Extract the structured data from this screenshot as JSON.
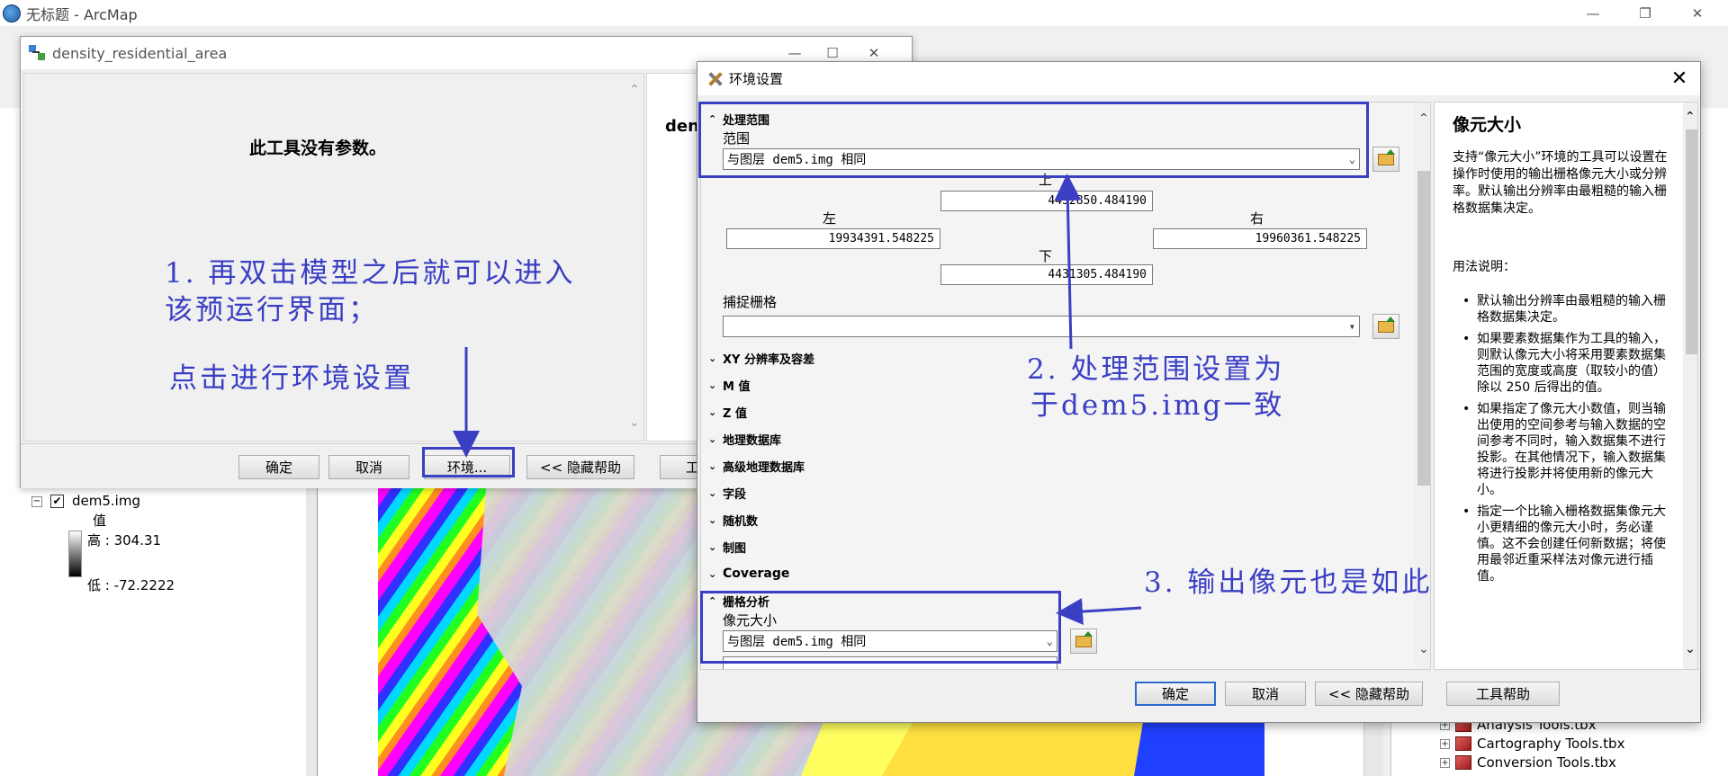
{
  "arcmap": {
    "title": "无标题 - ArcMap",
    "toc": {
      "layer_name": "dem5.img",
      "legend_header": "值",
      "high_label": "高 : 304.31",
      "low_label": "低 : -72.2222"
    },
    "catalog_items": [
      "Analysis Tools.tbx",
      "Cartography Tools.tbx",
      "Conversion Tools.tbx"
    ]
  },
  "tool_dialog": {
    "title": "density_residential_area",
    "no_params": "此工具没有参数。",
    "help_heading": "den",
    "buttons": {
      "ok": "确定",
      "cancel": "取消",
      "env": "环境...",
      "hide_help": "<< 隐藏帮助",
      "tool_help": "工"
    }
  },
  "env_dialog": {
    "title": "环境设置",
    "sections": {
      "extent": "处理范围",
      "xy": "XY 分辨率及容差",
      "m": "M 值",
      "z": "Z 值",
      "geodatabase": "地理数据库",
      "adv_geodatabase": "高级地理数据库",
      "fields": "字段",
      "random": "随机数",
      "cartography": "制图",
      "coverage": "Coverage",
      "raster": "栅格分析"
    },
    "extent": {
      "label": "范围",
      "value": "与图层 dem5.img 相同",
      "top_label": "上",
      "top": "4452850.484190",
      "left_label": "左",
      "left": "19934391.548225",
      "right_label": "右",
      "right": "19960361.548225",
      "bottom_label": "下",
      "bottom": "4431305.484190",
      "snap_label": "捕捉栅格",
      "snap_value": ""
    },
    "raster": {
      "cell_size_label": "像元大小",
      "cell_size_value": "与图层 dem5.img 相同"
    },
    "help": {
      "title": "像元大小",
      "intro": "支持“像元大小”环境的工具可以设置在操作时使用的输出栅格像元大小或分辨率。默认输出分辨率由最粗糙的输入栅格数据集决定。",
      "usage": "用法说明：",
      "bullets": [
        "默认输出分辨率由最粗糙的输入栅格数据集决定。",
        "如果要素数据集作为工具的输入，则默认像元大小将采用要素数据集范围的宽度或高度（取较小的值）除以 250 后得出的值。",
        "如果指定了像元大小数值，则当输出使用的空间参考与输入数据的空间参考不同时，输入数据集不进行投影。在其他情况下，输入数据集将进行投影并将使用新的像元大小。",
        "指定一个比输入栅格数据集像元大小更精细的像元大小时，务必谨慎。这不会创建任何新数据；将使用最邻近重采样法对像元进行插值。"
      ]
    },
    "buttons": {
      "ok": "确定",
      "cancel": "取消",
      "hide_help": "<< 隐藏帮助",
      "tool_help": "工具帮助"
    }
  },
  "annotations": {
    "note1_line1": "1. 再双击模型之后就可以进入",
    "note1_line2": "该预运行界面；",
    "note1_line3": "点击进行环境设置",
    "note2_line1": "2. 处理范围设置为",
    "note2_line2": "于dem5.img一致",
    "note3": "3. 输出像元也是如此"
  },
  "colors": {
    "annotation": "#3a3fc4"
  }
}
